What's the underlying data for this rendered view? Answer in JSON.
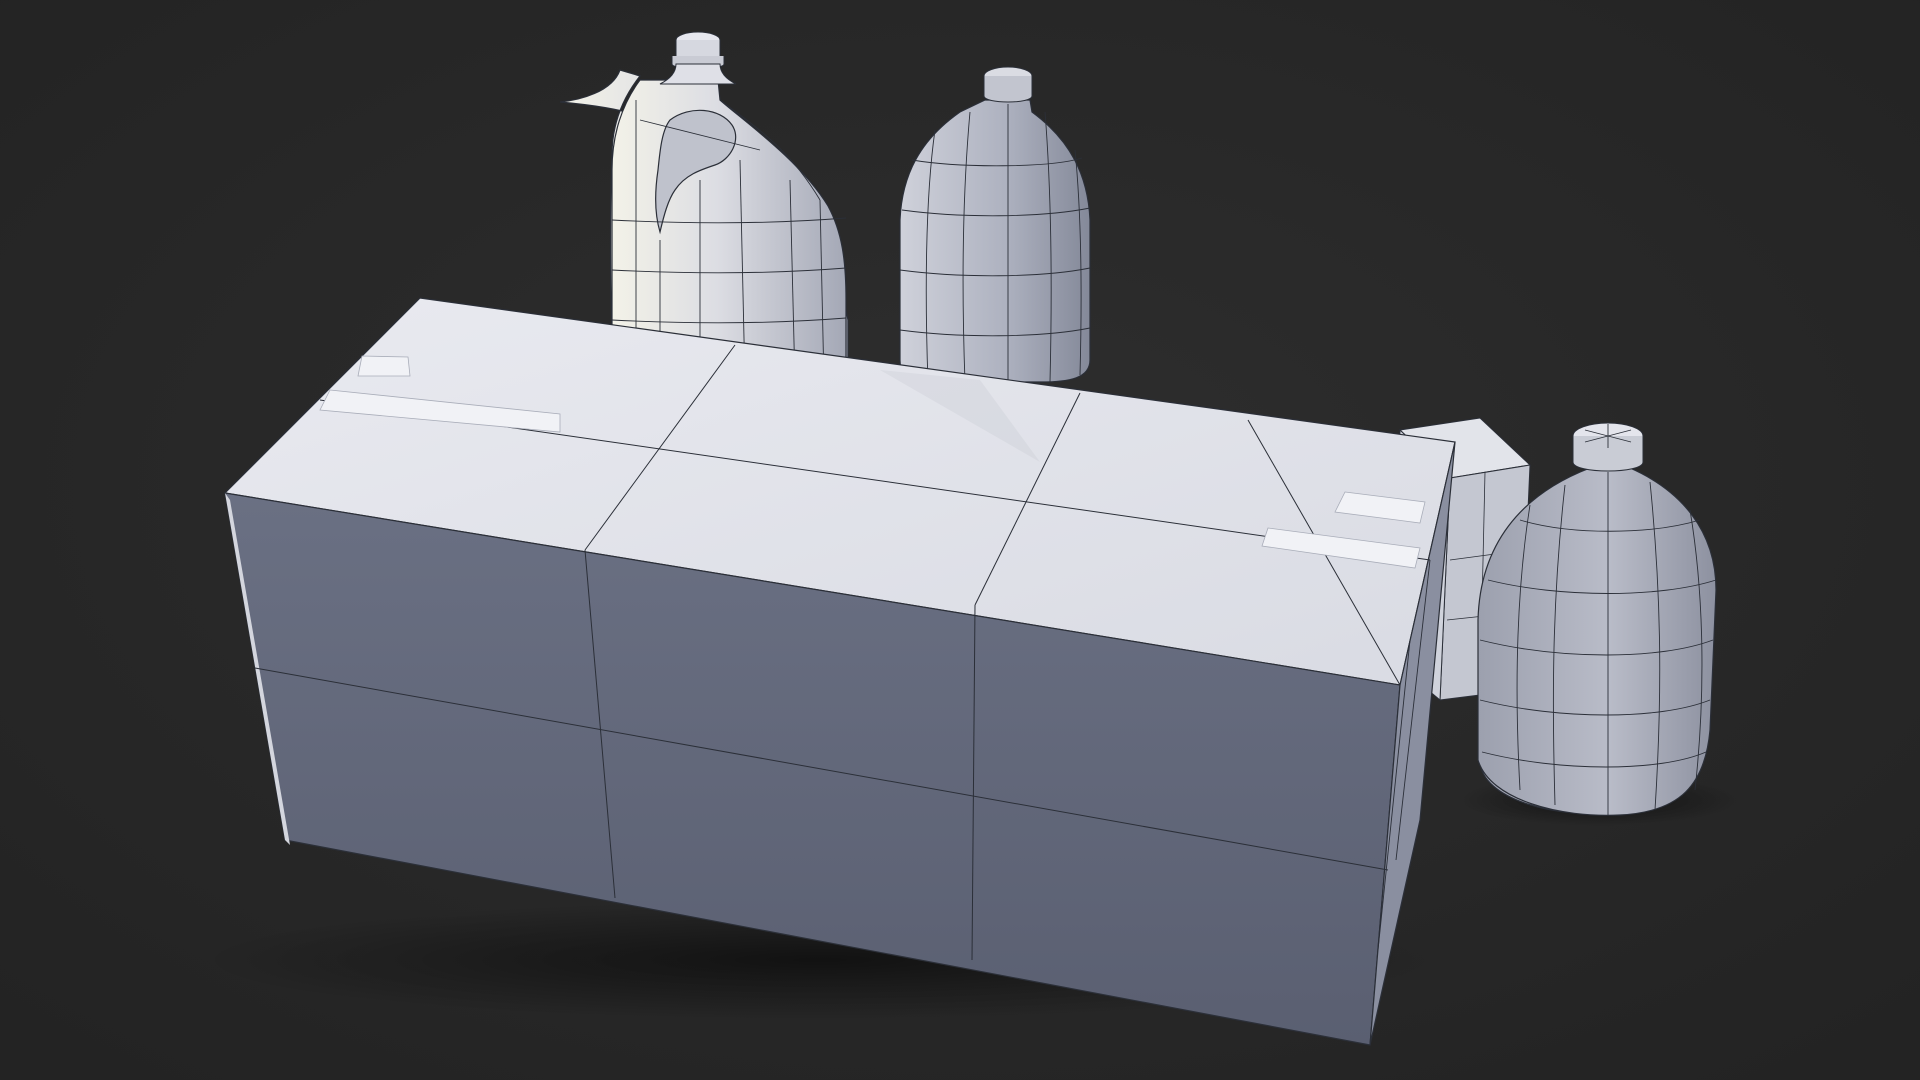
{
  "scene": {
    "background_color": "#2a2a2a",
    "material_color": "#e6e8ee",
    "shadow_color": "#5e6475",
    "wire_color": "#2b2f38",
    "objects": [
      "jug-with-handle-icon",
      "bottle-icon",
      "cardboard-box-icon",
      "small-box-icon",
      "round-bottle-icon"
    ]
  }
}
